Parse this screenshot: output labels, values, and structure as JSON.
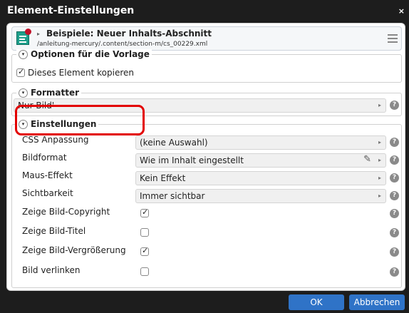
{
  "dialog": {
    "title": "Element-Einstellungen",
    "close_symbol": "×"
  },
  "header": {
    "title": "Beispiele: Neuer Inhalts-Abschnitt",
    "path": "/anleitung-mercury/.content/section-m/cs_00229.xml",
    "icon": "element-editor-icon",
    "menu_icon": "hamburger-menu-icon"
  },
  "optionen": {
    "legend": "Optionen für die Vorlage",
    "copy_label": "Dieses Element kopieren",
    "copy_checked": true
  },
  "formatter": {
    "legend": "Formatter",
    "value": "Nur Bild'"
  },
  "einstellungen": {
    "legend": "Einstellungen",
    "rows": [
      {
        "label": "CSS Anpassung",
        "type": "select",
        "value": "(keine Auswahl)"
      },
      {
        "label": "Bildformat",
        "type": "select",
        "value": "Wie im Inhalt eingestellt",
        "has_pencil": true
      },
      {
        "label": "Maus-Effekt",
        "type": "select",
        "value": "Kein Effekt"
      },
      {
        "label": "Sichtbarkeit",
        "type": "select",
        "value": "Immer sichtbar"
      },
      {
        "label": "Zeige Bild-Copyright",
        "type": "checkbox",
        "checked": true
      },
      {
        "label": "Zeige Bild-Titel",
        "type": "checkbox",
        "checked": false
      },
      {
        "label": "Zeige Bild-Vergrößerung",
        "type": "checkbox",
        "checked": true
      },
      {
        "label": "Bild verlinken",
        "type": "checkbox",
        "checked": false
      }
    ]
  },
  "icons": {
    "help": "?",
    "arrow": "▸",
    "pencil": "✎",
    "toggle": "▾"
  },
  "footer": {
    "ok_label": "OK",
    "cancel_label": "Abbrechen"
  },
  "colors": {
    "highlight": "#e30000",
    "button": "#2f73c7",
    "titlebar": "#1d1d1d",
    "element_icon": "#1e9f8b"
  }
}
